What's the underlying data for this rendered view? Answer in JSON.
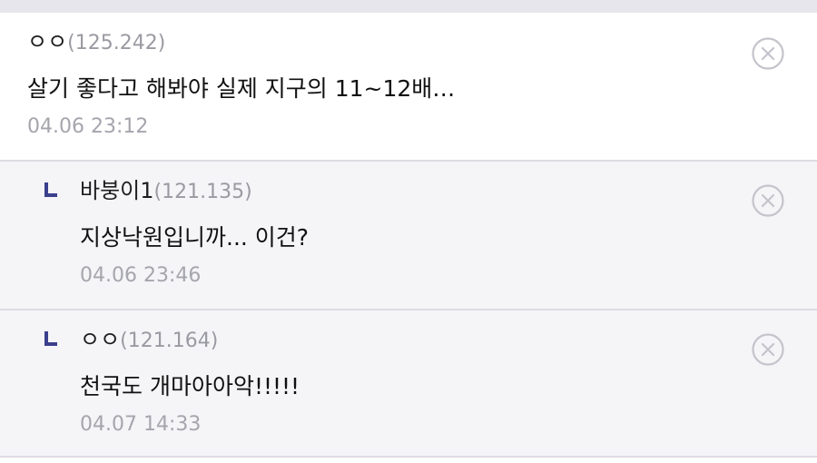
{
  "comments": [
    {
      "nickname": "ㅇㅇ",
      "ip": "(125.242)",
      "body": "살기 좋다고 해봐야 실제 지구의 11~12배…",
      "timestamp": "04.06 23:12"
    }
  ],
  "replies": [
    {
      "nickname": "바붕이1",
      "ip": "(121.135)",
      "body": "지상낙원입니까... 이건?",
      "timestamp": "04.06 23:46"
    },
    {
      "nickname": "ㅇㅇ",
      "ip": "(121.164)",
      "body": "천국도 개마아아악!!!!!",
      "timestamp": "04.07 14:33"
    }
  ],
  "icons": {
    "delete": "close-circle-icon",
    "reply": "reply-indent-icon"
  },
  "colors": {
    "reply_background": "#f5f5f8",
    "reply_mark": "#3b3f8c",
    "muted_text": "#9a9aa2"
  }
}
